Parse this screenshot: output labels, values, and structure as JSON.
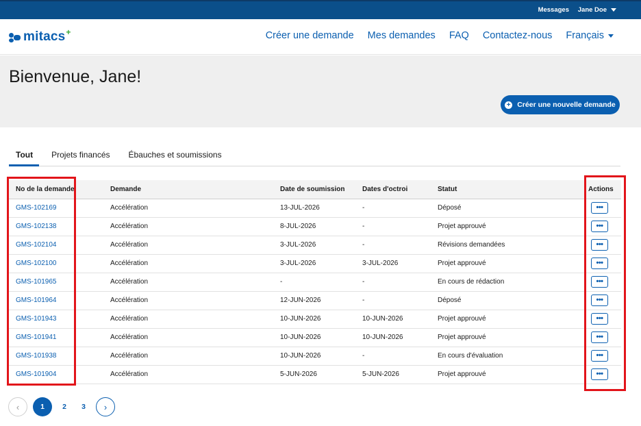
{
  "topbar": {
    "messages": "Messages",
    "user": "Jane Doe"
  },
  "brand": {
    "name": "mitacs",
    "plus": "+"
  },
  "nav": [
    {
      "label": "Créer une demande"
    },
    {
      "label": "Mes demandes"
    },
    {
      "label": "FAQ"
    },
    {
      "label": "Contactez-nous"
    },
    {
      "label": "Français"
    }
  ],
  "hero": {
    "title": "Bienvenue, Jane!",
    "new_button": "Créer une nouvelle demande"
  },
  "tabs": [
    {
      "label": "Tout",
      "active": true
    },
    {
      "label": "Projets financés"
    },
    {
      "label": "Ébauches et soumissions"
    }
  ],
  "table": {
    "headers": [
      "No de la demande",
      "Demande",
      "Date de soumission",
      "Dates d'octroi",
      "Statut",
      "Actions"
    ],
    "rows": [
      {
        "id": "GMS-102169",
        "type": "Accélération",
        "submitted": "13-JUL-2026",
        "granted": "-",
        "status": "Déposé"
      },
      {
        "id": "GMS-102138",
        "type": "Accélération",
        "submitted": "8-JUL-2026",
        "granted": "-",
        "status": "Projet approuvé"
      },
      {
        "id": "GMS-102104",
        "type": "Accélération",
        "submitted": "3-JUL-2026",
        "granted": "-",
        "status": "Révisions demandées"
      },
      {
        "id": "GMS-102100",
        "type": "Accélération",
        "submitted": "3-JUL-2026",
        "granted": "3-JUL-2026",
        "status": "Projet approuvé"
      },
      {
        "id": "GMS-101965",
        "type": "Accélération",
        "submitted": "-",
        "granted": "-",
        "status": "En cours de rédaction"
      },
      {
        "id": "GMS-101964",
        "type": "Accélération",
        "submitted": "12-JUN-2026",
        "granted": "-",
        "status": "Déposé"
      },
      {
        "id": "GMS-101943",
        "type": "Accélération",
        "submitted": "10-JUN-2026",
        "granted": "10-JUN-2026",
        "status": "Projet approuvé"
      },
      {
        "id": "GMS-101941",
        "type": "Accélération",
        "submitted": "10-JUN-2026",
        "granted": "10-JUN-2026",
        "status": "Projet approuvé"
      },
      {
        "id": "GMS-101938",
        "type": "Accélération",
        "submitted": "10-JUN-2026",
        "granted": "-",
        "status": "En cours d'évaluation"
      },
      {
        "id": "GMS-101904",
        "type": "Accélération",
        "submitted": "5-JUN-2026",
        "granted": "5-JUN-2026",
        "status": "Projet approuvé"
      }
    ],
    "action_label": "•••"
  },
  "pagination": {
    "pages": [
      "1",
      "2",
      "3"
    ],
    "current": "1",
    "prev": "‹",
    "next": "›"
  },
  "colors": {
    "primary": "#0b5fb0",
    "topbar": "#0b4f8a",
    "highlight": "#e2141a",
    "accent_plus": "#3aa935"
  }
}
